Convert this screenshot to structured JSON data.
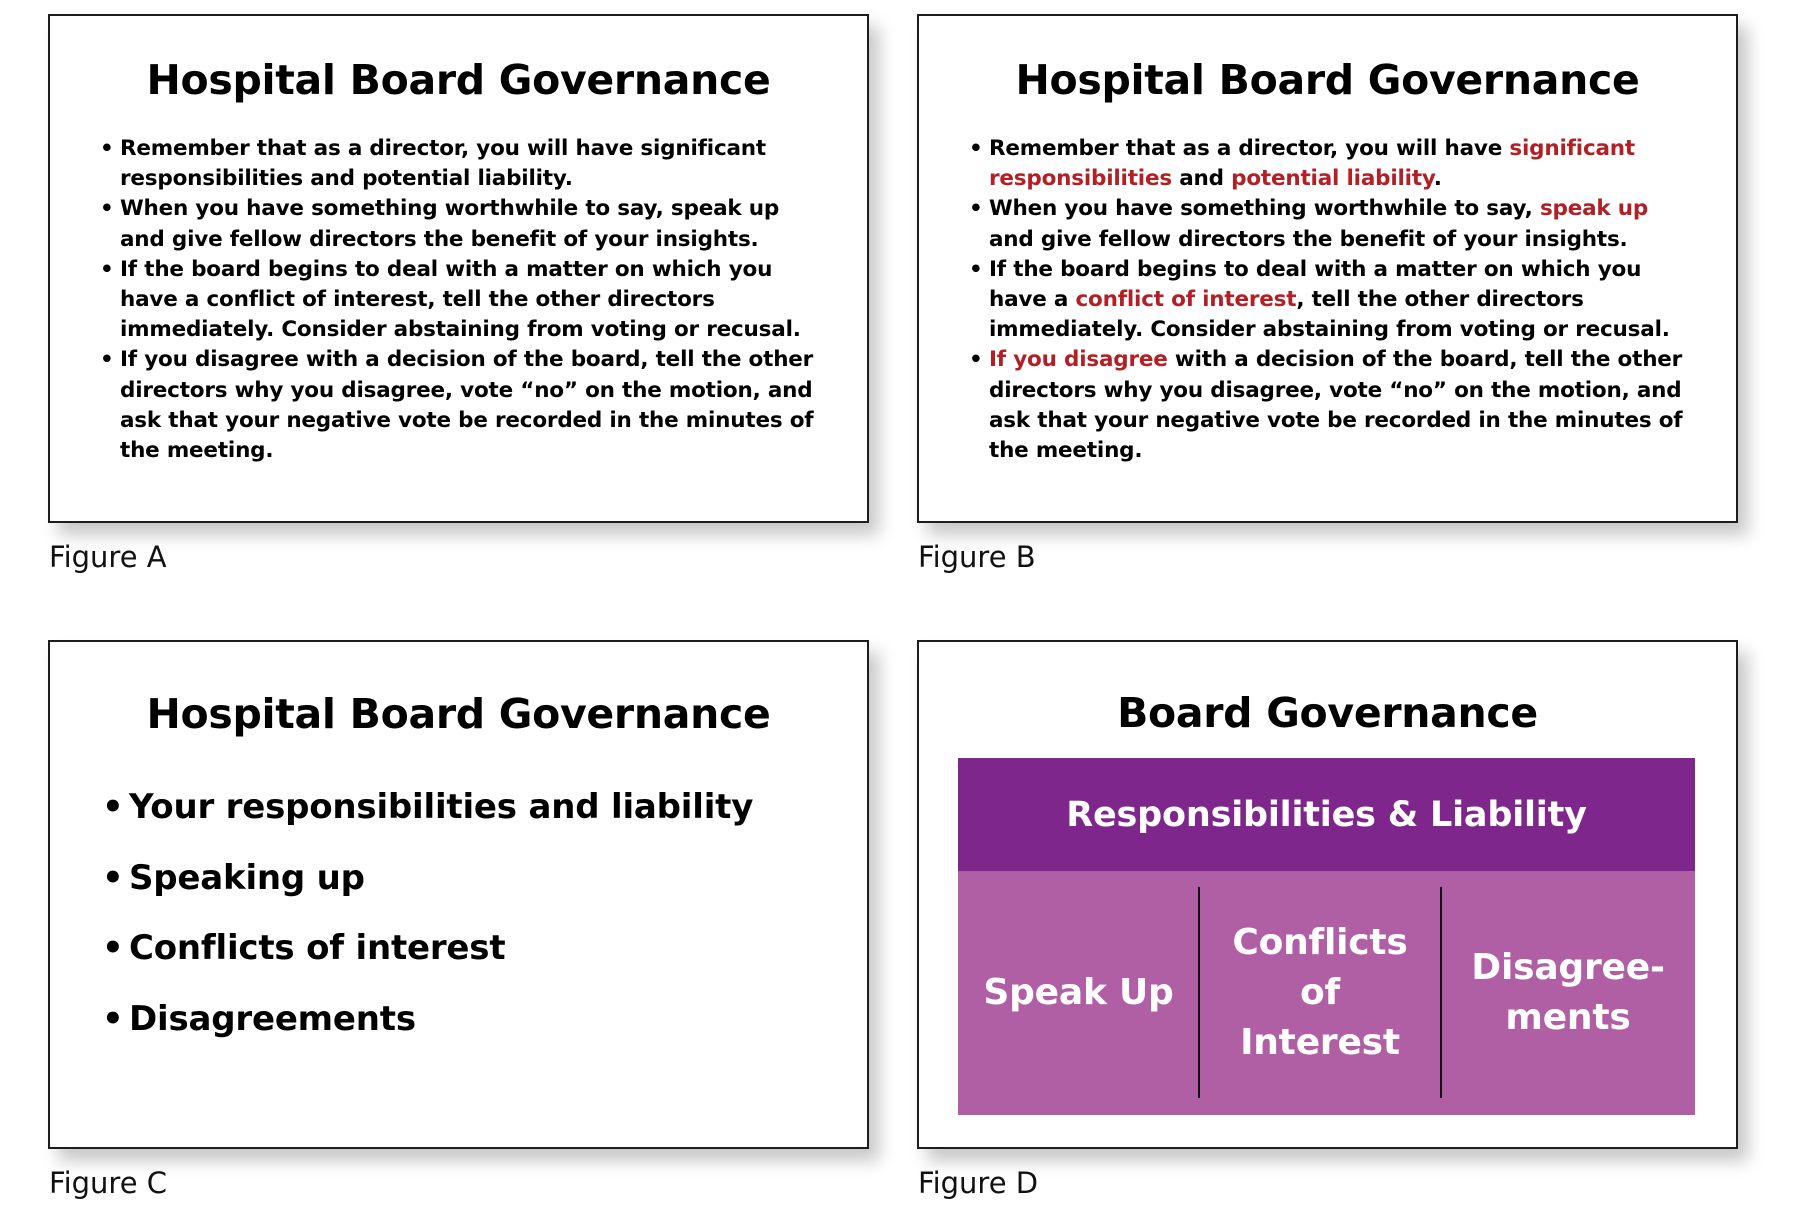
{
  "colors": {
    "highlight_red": "#B21F24",
    "header_purple": "#7E268C",
    "body_purple": "#B05FA5"
  },
  "figures": {
    "a": {
      "label": "Figure A",
      "title": "Hospital Board Governance",
      "bullet_glyph": "•",
      "bullets": [
        "Remember that as a director, you will have significant responsibilities and potential liability.",
        "When you have something worthwhile to say, speak up and give fellow directors the benefit of your insights.",
        "If the board begins to deal with a matter on which you have a conflict of interest, tell the other directors immediately. Consider abstaining from voting or recusal.",
        "If you disagree with a decision of the board, tell the other directors why you disagree, vote “no” on the motion, and ask that your negative vote be recorded in the minutes of the meeting."
      ]
    },
    "b": {
      "label": "Figure B",
      "title": "Hospital Board Governance",
      "bullet_glyph": "•",
      "bullets": [
        {
          "segments": [
            {
              "text": "Remember that as a director, you will have ",
              "highlight": false
            },
            {
              "text": "significant responsibilities",
              "highlight": true
            },
            {
              "text": " and ",
              "highlight": false
            },
            {
              "text": "potential liability",
              "highlight": true
            },
            {
              "text": ".",
              "highlight": false
            }
          ]
        },
        {
          "segments": [
            {
              "text": "When you have something worthwhile to say, ",
              "highlight": false
            },
            {
              "text": "speak up",
              "highlight": true
            },
            {
              "text": " and give fellow directors the benefit of your insights.",
              "highlight": false
            }
          ]
        },
        {
          "segments": [
            {
              "text": "If the board begins to deal with a matter on which you have a ",
              "highlight": false
            },
            {
              "text": "conflict of interest",
              "highlight": true
            },
            {
              "text": ", tell the other directors immediately. Consider abstaining from voting or recusal.",
              "highlight": false
            }
          ]
        },
        {
          "segments": [
            {
              "text": "If you disagree",
              "highlight": true
            },
            {
              "text": " with a decision of the board, tell the other directors why you disagree, vote “no” on the motion, and ask that your negative vote be recorded in the minutes of the meeting.",
              "highlight": false
            }
          ]
        }
      ]
    },
    "c": {
      "label": "Figure C",
      "title": "Hospital Board Governance",
      "bullet_glyph": "•",
      "bullets": [
        "Your responsibilities and liability",
        "Speaking up",
        "Conflicts of interest",
        "Disagreements"
      ]
    },
    "d": {
      "label": "Figure D",
      "title": "Board Governance",
      "header": "Responsibilities & Liability",
      "cells": [
        "Speak Up",
        "Conflicts\nof\nInterest",
        "Disagree-\nments"
      ]
    }
  }
}
